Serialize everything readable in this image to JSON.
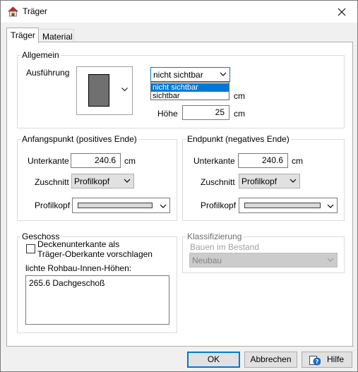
{
  "window": {
    "title": "Träger",
    "app_icon": "beam-app-icon",
    "close_icon": "close-icon"
  },
  "tabs": [
    {
      "label": "Träger",
      "active": true
    },
    {
      "label": "Material",
      "active": false
    }
  ],
  "allgemein": {
    "group_label": "Allgemein",
    "ausfuehrung_label": "Ausführung",
    "visibility": {
      "selected": "nicht sichtbar",
      "options": [
        "nicht sichtbar",
        "sichtbar"
      ],
      "open": true
    },
    "breite_unit": "cm",
    "hoehe_label": "Höhe",
    "hoehe_value": "25",
    "hoehe_unit": "cm"
  },
  "anfangspunkt": {
    "group_label": "Anfangspunkt (positives Ende)",
    "unterkante_label": "Unterkante",
    "unterkante_value": "240.6",
    "unterkante_unit": "cm",
    "zuschnitt_label": "Zuschnitt",
    "zuschnitt_value": "Profilkopf",
    "profilkopf_label": "Profilkopf"
  },
  "endpunkt": {
    "group_label": "Endpunkt (negatives Ende)",
    "unterkante_label": "Unterkante",
    "unterkante_value": "240.6",
    "unterkante_unit": "cm",
    "zuschnitt_label": "Zuschnitt",
    "zuschnitt_value": "Profilkopf",
    "profilkopf_label": "Profilkopf"
  },
  "geschoss": {
    "group_label": "Geschoss",
    "checkbox_line1": "Deckenunterkante als",
    "checkbox_line2": "Träger-Oberkante vorschlagen",
    "checkbox_checked": false,
    "heights_label": "lichte Rohbau-Innen-Höhen:",
    "heights_value": "265.6 Dachgeschoß"
  },
  "klassifizierung": {
    "group_label": "Klassifizierung",
    "bestand_label": "Bauen im Bestand",
    "bestand_value": "Neubau"
  },
  "buttons": {
    "ok": "OK",
    "cancel": "Abbrechen",
    "help": "Hilfe"
  }
}
